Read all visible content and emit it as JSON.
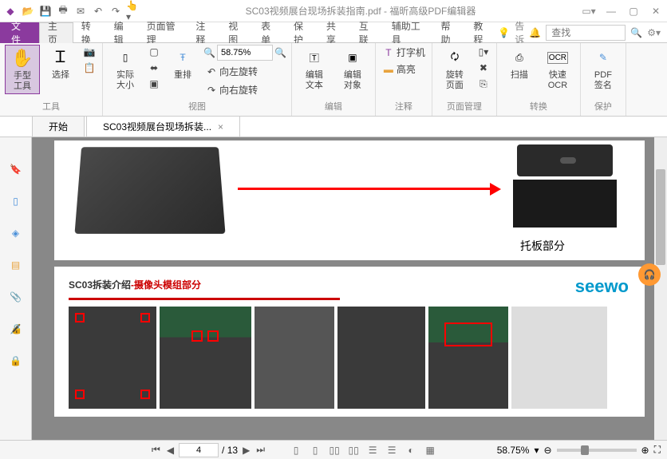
{
  "titlebar": {
    "title": "SC03视频展台现场拆装指南.pdf - 福昕高级PDF编辑器"
  },
  "menu": {
    "file": "文件",
    "items": [
      "主页",
      "转换",
      "编辑",
      "页面管理",
      "注释",
      "视图",
      "表单",
      "保护",
      "共享",
      "互联",
      "辅助工具",
      "帮助",
      "教程"
    ],
    "notify": "告诉",
    "search_placeholder": "查找"
  },
  "ribbon": {
    "hand": "手型\n工具",
    "select": "选择",
    "tools_label": "工具",
    "actual": "实际\n大小",
    "reflow": "重排",
    "zoom_value": "58.75%",
    "rotate_left": "向左旋转",
    "rotate_right": "向右旋转",
    "view_label": "视图",
    "edit_text": "编辑\n文本",
    "edit_obj": "编辑\n对象",
    "edit_label": "编辑",
    "typewriter": "打字机",
    "highlight": "高亮",
    "annot_label": "注释",
    "rotate_page": "旋转\n页面",
    "page_label": "页面管理",
    "scan": "扫描",
    "ocr": "快速\nOCR",
    "convert_label": "转换",
    "sign": "PDF\n签名",
    "protect_label": "保护"
  },
  "tabs": {
    "start": "开始",
    "doc": "SC03视频展台现场拆装..."
  },
  "page1": {
    "caption": "托板部分"
  },
  "page2": {
    "title_prefix": "SC03拆装介绍",
    "title_suffix": "-摄像头模组部分",
    "logo": "seewo"
  },
  "status": {
    "page_current": "4",
    "page_total": "/ 13",
    "zoom": "58.75%"
  }
}
